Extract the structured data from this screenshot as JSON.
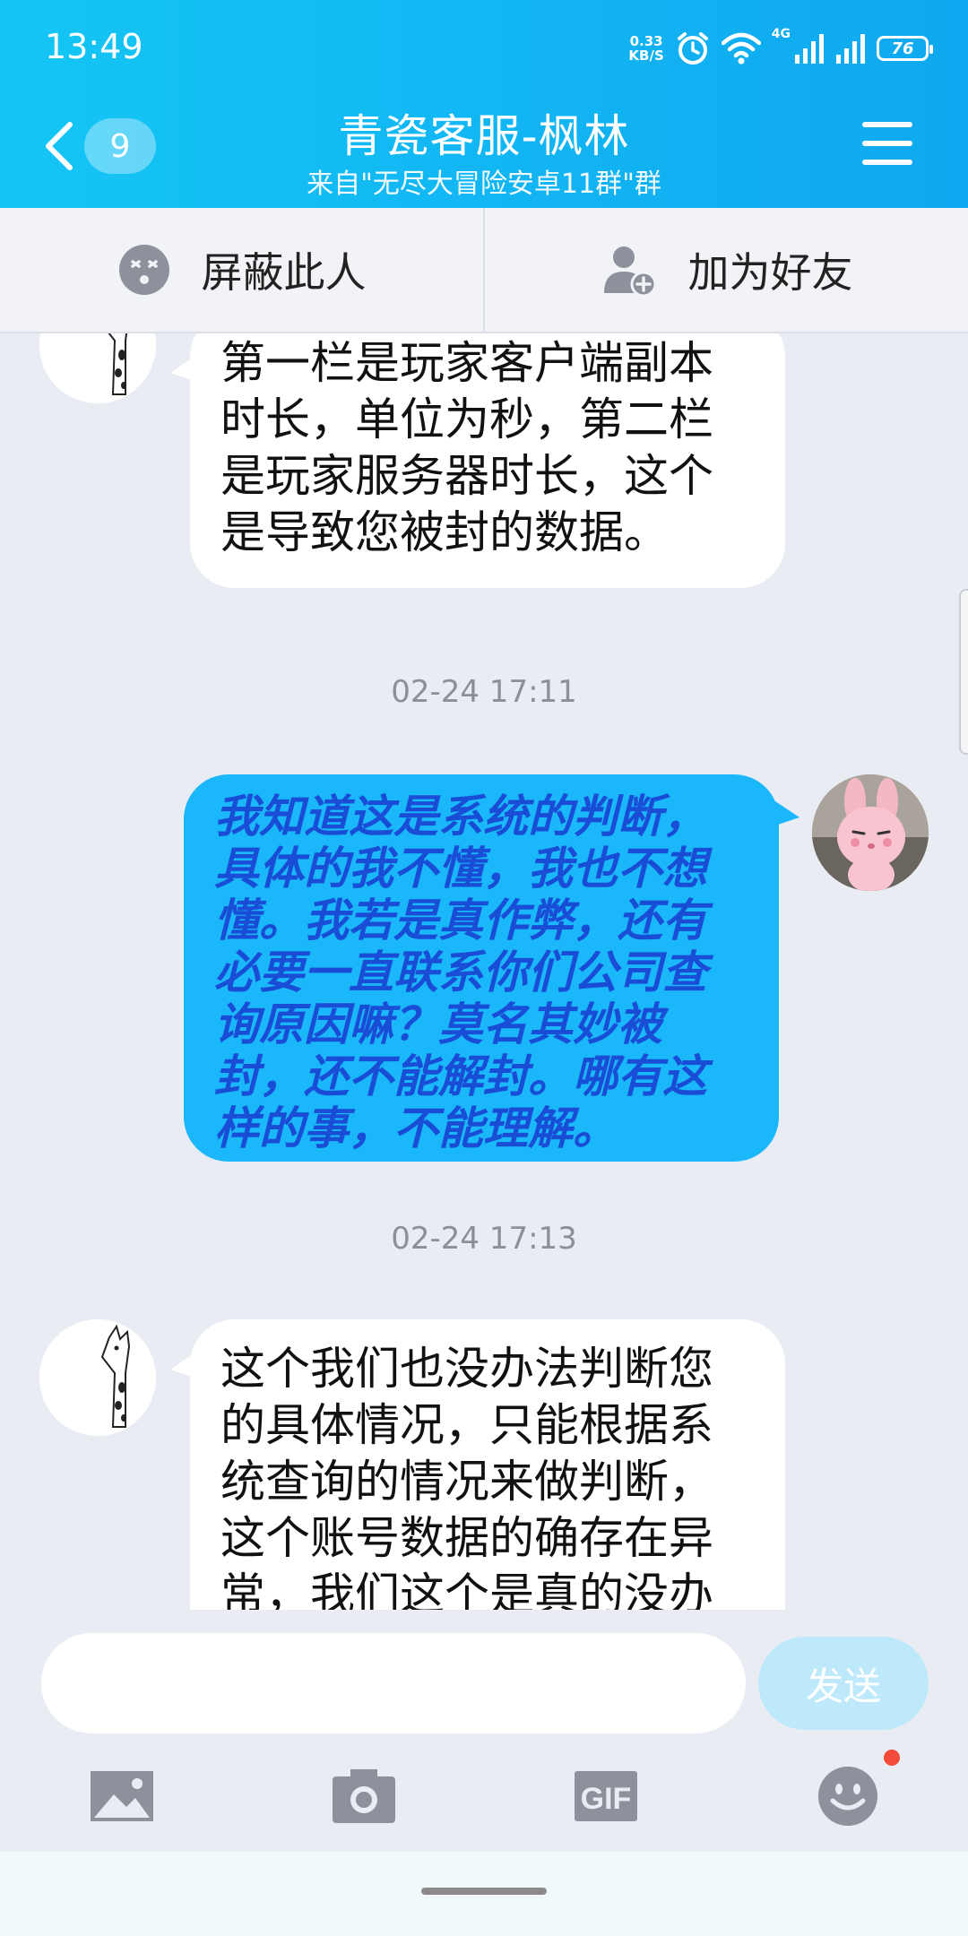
{
  "status_bar": {
    "time": "13:49",
    "net_speed_value": "0.33",
    "net_speed_unit": "KB/S",
    "network_type": "4G",
    "battery": "76"
  },
  "header": {
    "title": "青瓷客服-枫林",
    "subtitle": "来自\"无尽大冒险安卓11群\"群",
    "unread_count": "9"
  },
  "actions": {
    "block_label": "屏蔽此人",
    "add_friend_label": "加为好友"
  },
  "messages": [
    {
      "sender": "other",
      "text": "第一栏是玩家客户端副本时长，单位为秒，第二栏是玩家服务器时长，这个是导致您被封的数据。"
    },
    {
      "timestamp": "02-24 17:11"
    },
    {
      "sender": "self",
      "text": "我知道这是系统的判断，具体的我不懂，我也不想懂。我若是真作弊，还有必要一直联系你们公司查询原因嘛？莫名其妙被封，还不能解封。哪有这样的事，不能理解。"
    },
    {
      "timestamp": "02-24 17:13"
    },
    {
      "sender": "other",
      "text": "这个我们也没办法判断您的具体情况，只能根据系统查询的情况来做判断，这个账号数据的确存在异常，我们这个是真的没办"
    }
  ],
  "input": {
    "placeholder": "",
    "send_label": "发送"
  },
  "toolbar": {
    "icons": [
      "image-icon",
      "camera-icon",
      "gif-icon",
      "emoji-icon"
    ],
    "gif_label": "GIF"
  },
  "colors": {
    "header": "#12b6f3",
    "self_bubble": "#1ab8fa",
    "self_text": "#1a4dd6",
    "send_button": "#bde9fb"
  }
}
